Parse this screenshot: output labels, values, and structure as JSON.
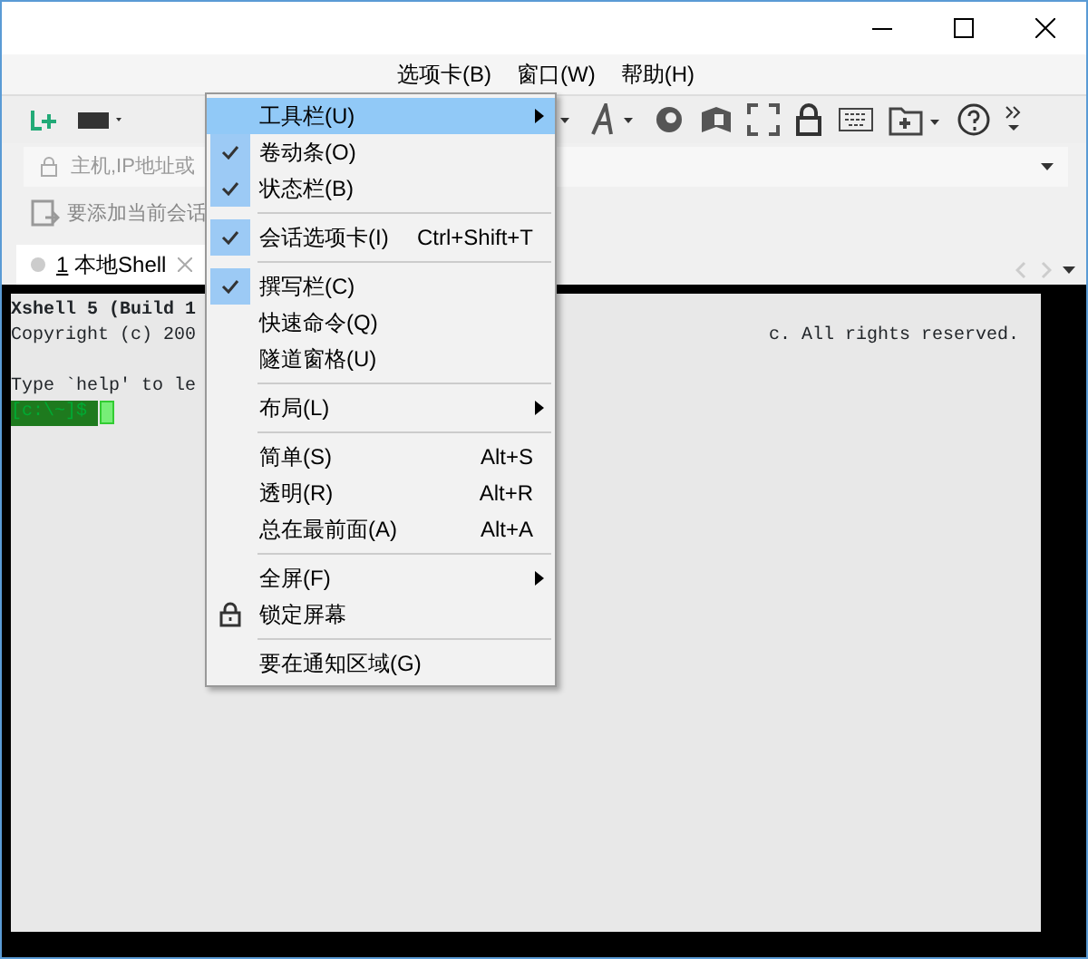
{
  "menu_bar": [
    {
      "label": "选项卡(B)"
    },
    {
      "label": "窗口(W)"
    },
    {
      "label": "帮助(H)"
    }
  ],
  "address_bar": {
    "placeholder": "主机,IP地址或"
  },
  "session_hint": "要添加当前会话",
  "tabs": [
    {
      "number": "1",
      "label": "本地Shell",
      "selected": true
    }
  ],
  "terminal": {
    "lines": [
      {
        "kind": "bold",
        "left": "Xshell 5 (Build 1"
      },
      {
        "kind": "text",
        "left": "Copyright (c) 200",
        "right": "c. All rights reserved."
      },
      {
        "kind": "blank"
      },
      {
        "kind": "text",
        "left": "Type `help' to le"
      },
      {
        "kind": "prompt",
        "left": "[c:\\~]$ "
      }
    ]
  },
  "view_menu": [
    {
      "kind": "item",
      "label": "工具栏(U)",
      "checked": false,
      "highlighted": true,
      "submenu": true
    },
    {
      "kind": "item",
      "label": "卷动条(O)",
      "checked": true,
      "highlighted": false,
      "submenu": false
    },
    {
      "kind": "item",
      "label": "状态栏(B)",
      "checked": true,
      "highlighted": false,
      "submenu": false
    },
    {
      "kind": "separator"
    },
    {
      "kind": "item",
      "label": "会话选项卡(I)",
      "shortcut": "Ctrl+Shift+T",
      "checked": true,
      "highlighted": false,
      "submenu": false
    },
    {
      "kind": "separator"
    },
    {
      "kind": "item",
      "label": "撰写栏(C)",
      "checked": true,
      "highlighted": false,
      "submenu": false
    },
    {
      "kind": "item",
      "label": "快速命令(Q)",
      "checked": false,
      "highlighted": false,
      "submenu": false
    },
    {
      "kind": "item",
      "label": "隧道窗格(U)",
      "checked": false,
      "highlighted": false,
      "submenu": false
    },
    {
      "kind": "separator"
    },
    {
      "kind": "item",
      "label": "布局(L)",
      "checked": false,
      "highlighted": false,
      "submenu": true
    },
    {
      "kind": "separator"
    },
    {
      "kind": "item",
      "label": "简单(S)",
      "shortcut": "Alt+S",
      "checked": false,
      "highlighted": false,
      "submenu": false
    },
    {
      "kind": "item",
      "label": "透明(R)",
      "shortcut": "Alt+R",
      "checked": false,
      "highlighted": false,
      "submenu": false
    },
    {
      "kind": "item",
      "label": "总在最前面(A)",
      "shortcut": "Alt+A",
      "checked": false,
      "highlighted": false,
      "submenu": false
    },
    {
      "kind": "separator"
    },
    {
      "kind": "item",
      "label": "全屏(F)",
      "checked": false,
      "highlighted": false,
      "submenu": true
    },
    {
      "kind": "lock",
      "label": "锁定屏幕",
      "checked": false,
      "highlighted": false,
      "submenu": false
    },
    {
      "kind": "separator"
    },
    {
      "kind": "item",
      "label": "要在通知区域(G)",
      "checked": false,
      "highlighted": false,
      "submenu": false
    }
  ]
}
